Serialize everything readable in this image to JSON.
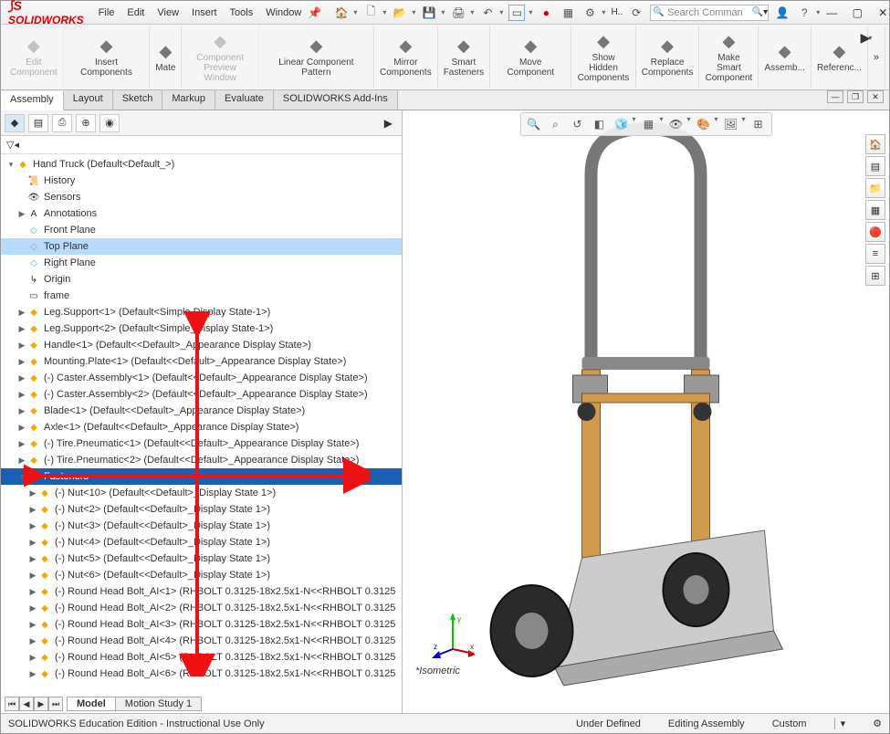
{
  "app": {
    "brand": "SOLIDWORKS",
    "toolbar_text": "H..",
    "search_placeholder": "Search Comman"
  },
  "menu": [
    "File",
    "Edit",
    "View",
    "Insert",
    "Tools",
    "Window"
  ],
  "ribbon": [
    {
      "label": "Edit\nComponent",
      "disabled": true
    },
    {
      "label": "Insert Components"
    },
    {
      "label": "Mate"
    },
    {
      "label": "Component\nPreview Window",
      "disabled": true
    },
    {
      "label": "Linear Component Pattern"
    },
    {
      "label": "Mirror\nComponents"
    },
    {
      "label": "Smart\nFasteners"
    },
    {
      "label": "Move Component"
    },
    {
      "label": "Show Hidden\nComponents"
    },
    {
      "label": "Replace\nComponents"
    },
    {
      "label": "Make Smart\nComponent"
    },
    {
      "label": "Assemb..."
    },
    {
      "label": "Referenc..."
    }
  ],
  "cmdtabs": [
    "Assembly",
    "Layout",
    "Sketch",
    "Markup",
    "Evaluate",
    "SOLIDWORKS Add-Ins"
  ],
  "active_cmdtab": "Assembly",
  "tree_root": "Hand Truck  (Default<Default_>)",
  "tree": [
    {
      "lvl": 1,
      "icon": "📜",
      "label": "History"
    },
    {
      "lvl": 1,
      "icon": "👁",
      "label": "Sensors"
    },
    {
      "lvl": 1,
      "icon": "A",
      "label": "Annotations",
      "expand": "▶"
    },
    {
      "lvl": 1,
      "icon": "◇",
      "label": "Front Plane",
      "plane": true
    },
    {
      "lvl": 1,
      "icon": "◇",
      "label": "Top Plane",
      "plane": true,
      "selected": true
    },
    {
      "lvl": 1,
      "icon": "◇",
      "label": "Right Plane",
      "plane": true
    },
    {
      "lvl": 1,
      "icon": "↳",
      "label": "Origin"
    },
    {
      "lvl": 1,
      "icon": "▭",
      "label": "frame"
    },
    {
      "lvl": 1,
      "icon": "◆",
      "label": "Leg.Support<1> (Default<Simple Display State-1>)",
      "asm": true,
      "expand": "▶"
    },
    {
      "lvl": 1,
      "icon": "◆",
      "label": "Leg.Support<2> (Default<Simple_Display State-1>)",
      "asm": true,
      "expand": "▶"
    },
    {
      "lvl": 1,
      "icon": "◆",
      "label": "Handle<1> (Default<<Default>_Appearance Display State>)",
      "asm": true,
      "expand": "▶"
    },
    {
      "lvl": 1,
      "icon": "◆",
      "label": "Mounting.Plate<1> (Default<<Default>_Appearance Display State>)",
      "asm": true,
      "expand": "▶"
    },
    {
      "lvl": 1,
      "icon": "◆",
      "label": "(-) Caster.Assembly<1> (Default<<Default>_Appearance Display State>)",
      "asm": true,
      "expand": "▶"
    },
    {
      "lvl": 1,
      "icon": "◆",
      "label": "(-) Caster.Assembly<2> (Default<<Default>_Appearance Display State>)",
      "asm": true,
      "expand": "▶"
    },
    {
      "lvl": 1,
      "icon": "◆",
      "label": "Blade<1> (Default<<Default>_Appearance Display State>)",
      "asm": true,
      "expand": "▶"
    },
    {
      "lvl": 1,
      "icon": "◆",
      "label": "Axle<1> (Default<<Default>_Appearance Display State>)",
      "asm": true,
      "expand": "▶"
    },
    {
      "lvl": 1,
      "icon": "◆",
      "label": "(-) Tire.Pneumatic<1> (Default<<Default>_Appearance Display State>)",
      "asm": true,
      "expand": "▶"
    },
    {
      "lvl": 1,
      "icon": "◆",
      "label": "(-) Tire.Pneumatic<2> (Default<<Default>_Appearance Display State>)",
      "asm": true,
      "expand": "▶"
    },
    {
      "lvl": 1,
      "icon": "📁",
      "label": "Fasteners",
      "folder": true,
      "expand": "▾"
    },
    {
      "lvl": 2,
      "icon": "◆",
      "label": "(-) Nut<10> (Default<<Default>_Display State 1>)",
      "asm": true,
      "expand": "▶"
    },
    {
      "lvl": 2,
      "icon": "◆",
      "label": "(-) Nut<2> (Default<<Default>_Display State 1>)",
      "asm": true,
      "expand": "▶"
    },
    {
      "lvl": 2,
      "icon": "◆",
      "label": "(-) Nut<3> (Default<<Default>_Display State 1>)",
      "asm": true,
      "expand": "▶"
    },
    {
      "lvl": 2,
      "icon": "◆",
      "label": "(-) Nut<4> (Default<<Default>_Display State 1>)",
      "asm": true,
      "expand": "▶"
    },
    {
      "lvl": 2,
      "icon": "◆",
      "label": "(-) Nut<5> (Default<<Default>_Display State 1>)",
      "asm": true,
      "expand": "▶"
    },
    {
      "lvl": 2,
      "icon": "◆",
      "label": "(-) Nut<6> (Default<<Default>_Display State 1>)",
      "asm": true,
      "expand": "▶"
    },
    {
      "lvl": 2,
      "icon": "◆",
      "label": "(-) Round Head Bolt_AI<1> (RHBOLT 0.3125-18x2.5x1-N<<RHBOLT 0.3125",
      "asm": true,
      "expand": "▶"
    },
    {
      "lvl": 2,
      "icon": "◆",
      "label": "(-) Round Head Bolt_AI<2> (RHBOLT 0.3125-18x2.5x1-N<<RHBOLT 0.3125",
      "asm": true,
      "expand": "▶"
    },
    {
      "lvl": 2,
      "icon": "◆",
      "label": "(-) Round Head Bolt_AI<3> (RHBOLT 0.3125-18x2.5x1-N<<RHBOLT 0.3125",
      "asm": true,
      "expand": "▶"
    },
    {
      "lvl": 2,
      "icon": "◆",
      "label": "(-) Round Head Bolt_AI<4> (RHBOLT 0.3125-18x2.5x1-N<<RHBOLT 0.3125",
      "asm": true,
      "expand": "▶"
    },
    {
      "lvl": 2,
      "icon": "◆",
      "label": "(-) Round Head Bolt_AI<5> (RHBOLT 0.3125-18x2.5x1-N<<RHBOLT 0.3125",
      "asm": true,
      "expand": "▶"
    },
    {
      "lvl": 2,
      "icon": "◆",
      "label": "(-) Round Head Bolt_AI<6> (RHBOLT 0.3125-18x2.5x1-N<<RHBOLT 0.3125",
      "asm": true,
      "expand": "▶"
    }
  ],
  "viewport": {
    "orientation_label": "*Isometric"
  },
  "bottom_tabs": {
    "nav": [
      "⏮",
      "◀",
      "▶",
      "⏭"
    ],
    "tabs": [
      "Model",
      "Motion Study 1"
    ],
    "active": "Model"
  },
  "status": {
    "left": "SOLIDWORKS Education Edition - Instructional Use Only",
    "mid": "Under Defined",
    "edit": "Editing Assembly",
    "custom": "Custom"
  }
}
